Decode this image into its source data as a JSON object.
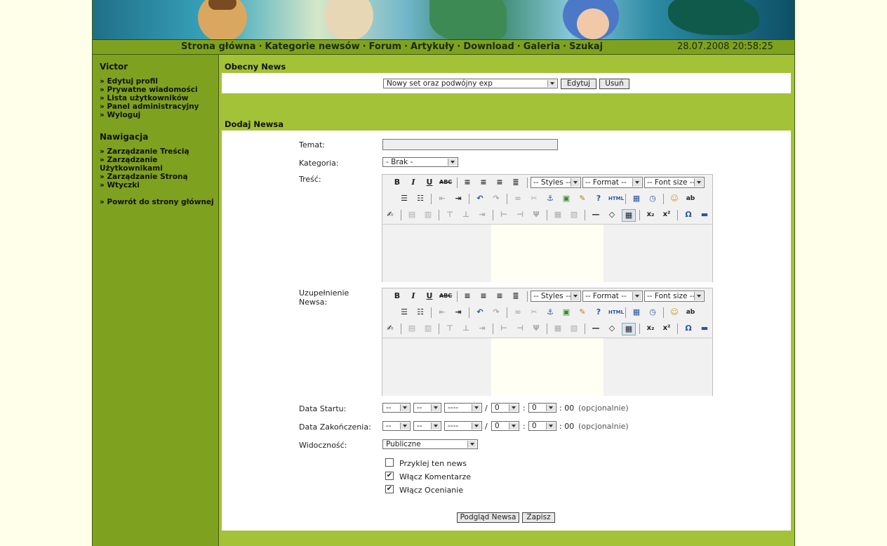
{
  "nav": {
    "items": [
      "Strona główna",
      "Kategorie newsów",
      "Forum",
      "Artykuły",
      "Download",
      "Galeria",
      "Szukaj"
    ],
    "datetime": "28.07.2008 20:58:25"
  },
  "sidebar": {
    "user_title": "Victor",
    "user_links": [
      "» Edytuj profil",
      "» Prywatne wiadomości",
      "» Lista użytkowników",
      "» Panel administracyjny",
      "» Wyloguj"
    ],
    "nav_title": "Nawigacja",
    "nav_links": [
      "» Zarządzanie Treścią",
      "» Zarządzanie Użytkownikami",
      "» Zarządzanie Stroną",
      "» Wtyczki"
    ],
    "back_link": "» Powrót do strony głównej"
  },
  "current_news": {
    "title": "Obecny News",
    "selected": "Nowy set oraz podwójny exp",
    "edit_label": "Edytuj",
    "delete_label": "Usuń"
  },
  "add_news": {
    "title": "Dodaj Newsa",
    "topic_label": "Temat:",
    "topic_value": "",
    "category_label": "Kategoria:",
    "category_value": "- Brak -",
    "content_label": "Treść:",
    "extended_label": "Uzupełnienie Newsa:",
    "editor": {
      "styles": "-- Styles --",
      "format": "-- Format --",
      "fontsize": "-- Font size --"
    },
    "start_label": "Data Startu:",
    "end_label": "Data Zakończenia:",
    "date_day": "--",
    "date_month": "--",
    "date_year": "----",
    "date_hour": "0",
    "date_min": "0",
    "time_suffix": ": 00",
    "optional": "(opcjonalnie)",
    "visibility_label": "Widoczność:",
    "visibility_value": "Publiczne",
    "checkboxes": [
      {
        "label": "Przyklej ten news",
        "checked": false
      },
      {
        "label": "Włącz Komentarze",
        "checked": true
      },
      {
        "label": "Włącz Ocenianie",
        "checked": true
      }
    ],
    "preview_label": "Podgląd Newsa",
    "save_label": "Zapisz"
  },
  "colors": {
    "frame_green": "#a3c237",
    "nav_green": "#7ea21f",
    "page_bg": "#ffffea"
  }
}
